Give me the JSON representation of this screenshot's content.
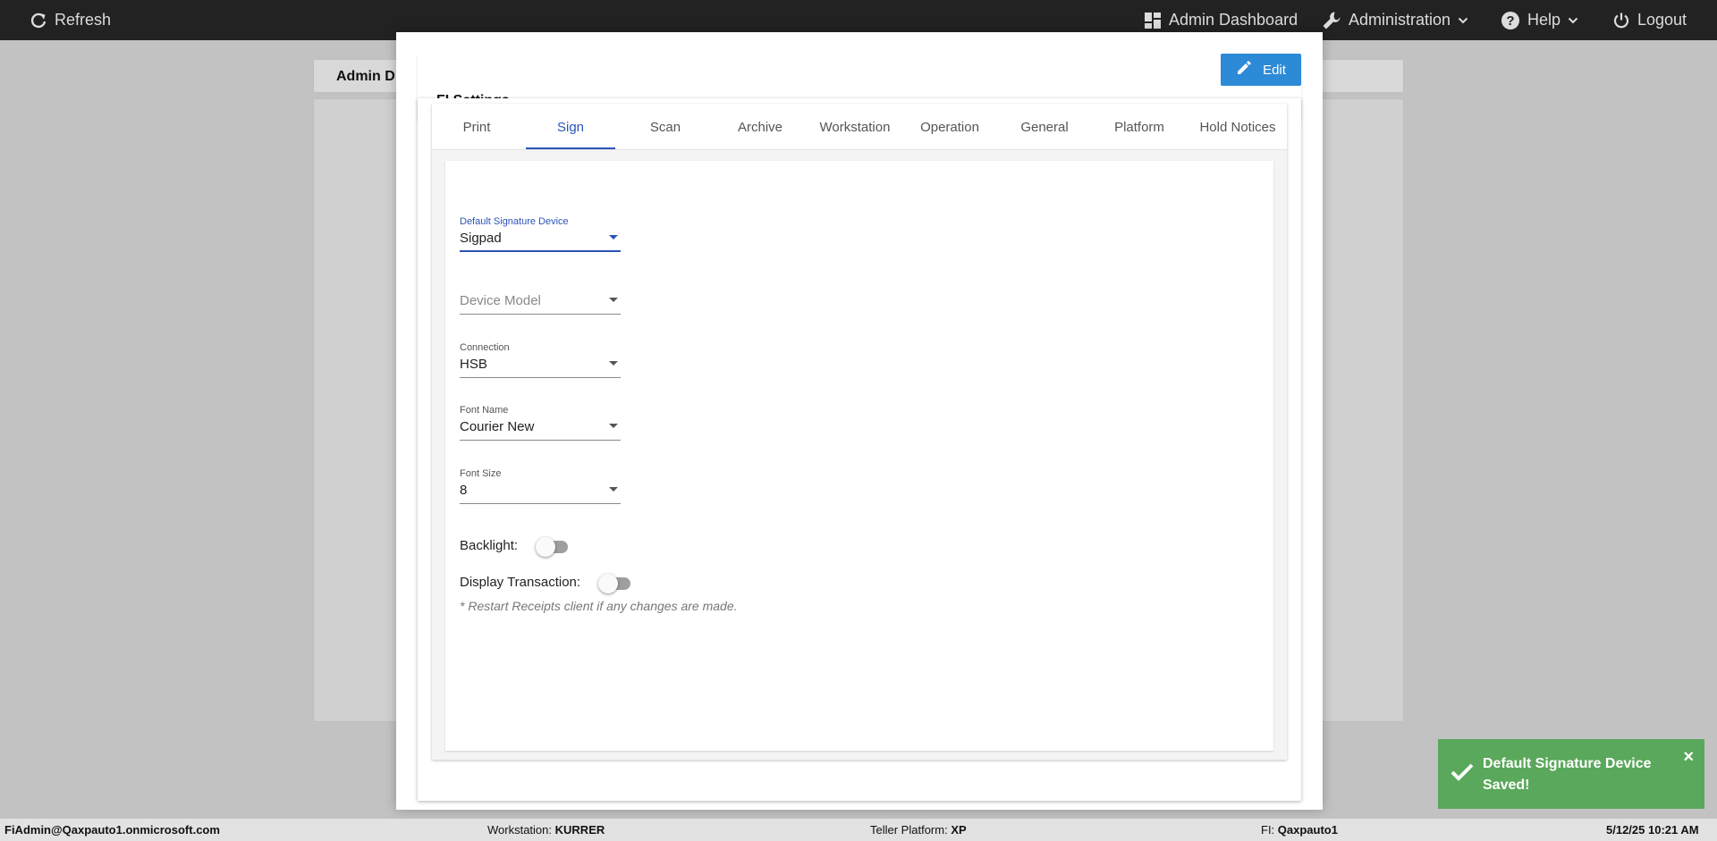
{
  "topbar": {
    "refresh_label": "Refresh",
    "admin_dashboard_label": "Admin Dashboard",
    "administration_label": "Administration",
    "help_label": "Help",
    "logout_label": "Logout"
  },
  "background": {
    "header_label": "Admin D"
  },
  "modal": {
    "title": "FI Settings",
    "edit_label": "Edit",
    "tabs": [
      {
        "label": "Print"
      },
      {
        "label": "Sign"
      },
      {
        "label": "Scan"
      },
      {
        "label": "Archive"
      },
      {
        "label": "Workstation"
      },
      {
        "label": "Operation"
      },
      {
        "label": "General"
      },
      {
        "label": "Platform"
      },
      {
        "label": "Hold Notices"
      }
    ],
    "active_tab": "Sign",
    "fields": {
      "default_signature_device": {
        "label": "Default Signature Device",
        "value": "Sigpad"
      },
      "device_model": {
        "placeholder": "Device Model"
      },
      "connection": {
        "label": "Connection",
        "value": "HSB"
      },
      "font_name": {
        "label": "Font Name",
        "value": "Courier New"
      },
      "font_size": {
        "label": "Font Size",
        "value": "8"
      }
    },
    "toggles": {
      "backlight": {
        "label": "Backlight:",
        "on": false
      },
      "display_transaction": {
        "label": "Display Transaction:",
        "on": false
      }
    },
    "note": "* Restart Receipts client if any changes are made."
  },
  "toast": {
    "message": "Default Signature Device Saved!",
    "close": "×",
    "color": "#5aa85b"
  },
  "statusbar": {
    "user": "FiAdmin@Qaxpauto1.onmicrosoft.com",
    "workstation_label": "Workstation:",
    "workstation_value": "KURRER",
    "teller_label": "Teller Platform:",
    "teller_value": "XP",
    "fi_label": "FI:",
    "fi_value": "Qaxpauto1",
    "datetime": "5/12/25 10:21 AM"
  },
  "colors": {
    "accent": "#2c54b8",
    "edit_button": "#2d8ad6",
    "topbar": "#222222"
  }
}
